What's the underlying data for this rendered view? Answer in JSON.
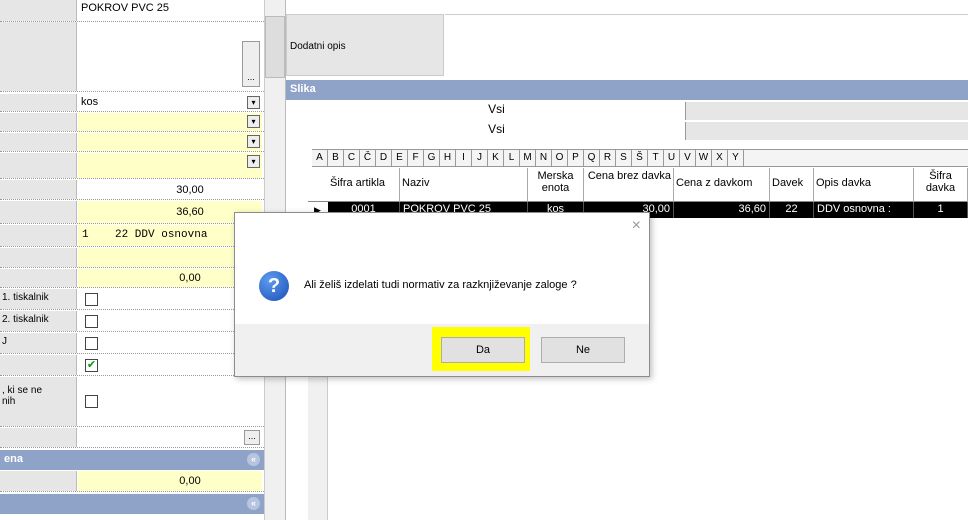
{
  "left_panel": {
    "name_value": "POKROV PVC 25",
    "unit_value": "kos",
    "price_value": "30,00",
    "price_tax_value": "36,60",
    "tax_value": "1    22 DDV osnovna",
    "zero_value": "0,00",
    "printer1_label": "1. tiskalnik",
    "printer2_label": "2. tiskalnik",
    "j_label": "J",
    "ki_se_ne_label": ", ki se ne\nnih",
    "section1_title": "ena",
    "section1_value": "0,00",
    "ellipsis": "...",
    "dropdown_arrow": "▾",
    "checkbox_checked": "✔",
    "collapse_glyph": "«"
  },
  "right_panel": {
    "dodatni_opis_label": "Dodatni opis",
    "slika_header": "Slika",
    "filter1": "Vsi",
    "filter2": "Vsi",
    "letters": [
      "A",
      "B",
      "C",
      "Č",
      "D",
      "E",
      "F",
      "G",
      "H",
      "I",
      "J",
      "K",
      "L",
      "M",
      "N",
      "O",
      "P",
      "Q",
      "R",
      "S",
      "Š",
      "T",
      "U",
      "V",
      "W",
      "X",
      "Y"
    ],
    "columns": [
      "Šifra artikla",
      "Naziv",
      "Merska enota",
      "Cena brez davka",
      "Cena z davkom",
      "Davek",
      "Opis davka",
      "Šifra davka"
    ],
    "row": {
      "sifra": "0001",
      "naziv": "POKROV PVC 25",
      "enota": "kos",
      "cena_brez": "30,00",
      "cena_z": "36,60",
      "davek": "22",
      "opis": "DDV osnovna :",
      "sifra_davka": "1"
    },
    "row_marker": "▶"
  },
  "dialog": {
    "close_glyph": "×",
    "question_glyph": "?",
    "message": "Ali želiš izdelati tudi normativ za razknjiževanje zaloge ?",
    "yes_label": "Da",
    "no_label": "Ne",
    "highlight_color": "#ffff00"
  }
}
